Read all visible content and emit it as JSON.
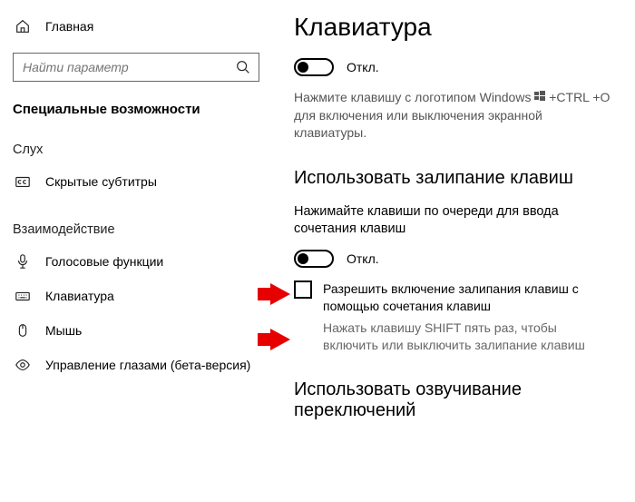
{
  "sidebar": {
    "home": "Главная",
    "search_placeholder": "Найти параметр",
    "section": "Специальные возможности",
    "group_hearing": "Слух",
    "item_cc": "Скрытые субтитры",
    "group_interaction": "Взаимодействие",
    "item_voice": "Голосовые функции",
    "item_keyboard": "Клавиатура",
    "item_mouse": "Мышь",
    "item_eye": "Управление глазами (бета-версия)"
  },
  "main": {
    "title": "Клавиатура",
    "toggle1_state": "Откл.",
    "toggle1_desc_a": "Нажмите клавишу с логотипом Windows",
    "toggle1_desc_b": "+CTRL +O для включения или выключения экранной клавиатуры.",
    "sticky_heading": "Использовать залипание клавиш",
    "sticky_desc": "Нажимайте клавиши по очереди для ввода сочетания клавиш",
    "toggle2_state": "Откл.",
    "checkbox_label": "Разрешить включение залипания клавиш с помощью сочетания клавиш",
    "checkbox_hint": "Нажать клавишу SHIFT пять раз, чтобы включить или выключить залипание клавиш",
    "toggle3_heading": "Использовать озвучивание переключений"
  }
}
